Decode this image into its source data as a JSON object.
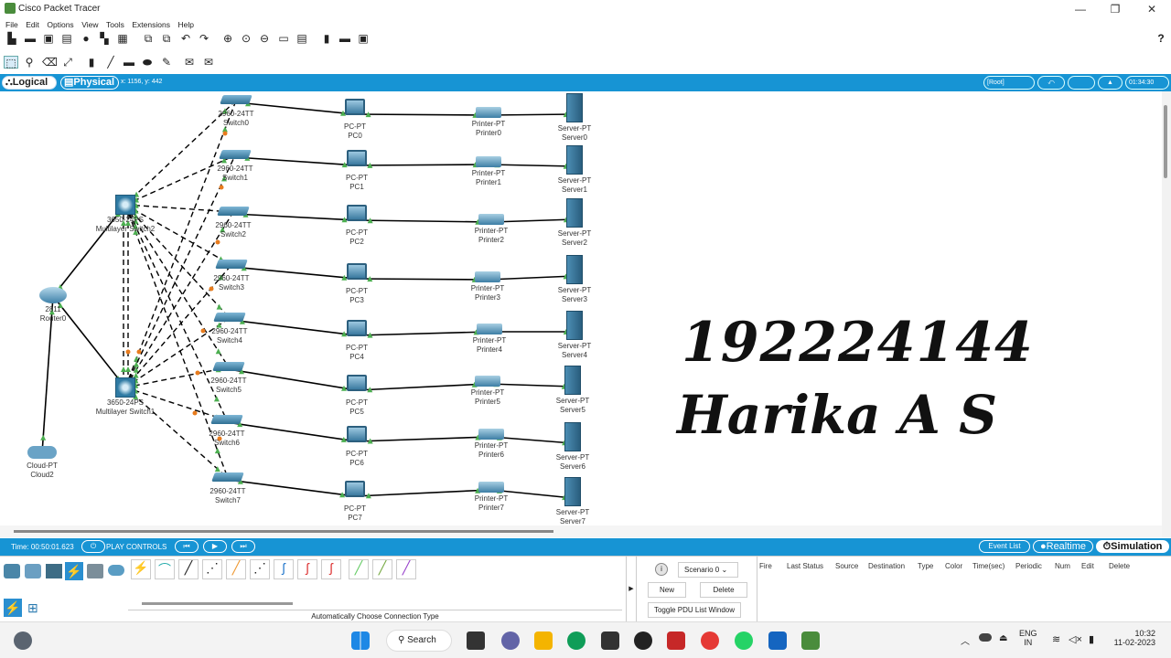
{
  "window": {
    "title": "Cisco Packet Tracer",
    "minimize": "—",
    "maximize": "❐",
    "close": "✕"
  },
  "menu": [
    "File",
    "Edit",
    "Options",
    "View",
    "Tools",
    "Extensions",
    "Help"
  ],
  "toolbar1_help": "?",
  "views": {
    "logical": "Logical",
    "physical": "Physical",
    "coords": "x: 1156, y: 442",
    "root": "[Root]",
    "clock": "01:34:30"
  },
  "devices": {
    "switches": [
      {
        "model": "2960-24TT",
        "name": "Switch0"
      },
      {
        "model": "2960-24TT",
        "name": "Switch1"
      },
      {
        "model": "2960-24TT",
        "name": "Switch2"
      },
      {
        "model": "2960-24TT",
        "name": "Switch3"
      },
      {
        "model": "2960-24TT",
        "name": "Switch4"
      },
      {
        "model": "2960-24TT",
        "name": "Switch5"
      },
      {
        "model": "2960-24TT",
        "name": "Switch6"
      },
      {
        "model": "2960-24TT",
        "name": "Switch7"
      }
    ],
    "pcs": [
      {
        "model": "PC-PT",
        "name": "PC0"
      },
      {
        "model": "PC-PT",
        "name": "PC1"
      },
      {
        "model": "PC-PT",
        "name": "PC2"
      },
      {
        "model": "PC-PT",
        "name": "PC3"
      },
      {
        "model": "PC-PT",
        "name": "PC4"
      },
      {
        "model": "PC-PT",
        "name": "PC5"
      },
      {
        "model": "PC-PT",
        "name": "PC6"
      },
      {
        "model": "PC-PT",
        "name": "PC7"
      }
    ],
    "printers": [
      {
        "model": "Printer-PT",
        "name": "Printer0"
      },
      {
        "model": "Printer-PT",
        "name": "Printer1"
      },
      {
        "model": "Printer-PT",
        "name": "Printer2"
      },
      {
        "model": "Printer-PT",
        "name": "Printer3"
      },
      {
        "model": "Printer-PT",
        "name": "Printer4"
      },
      {
        "model": "Printer-PT",
        "name": "Printer5"
      },
      {
        "model": "Printer-PT",
        "name": "Printer6"
      },
      {
        "model": "Printer-PT",
        "name": "Printer7"
      }
    ],
    "servers": [
      {
        "model": "Server-PT",
        "name": "Server0"
      },
      {
        "model": "Server-PT",
        "name": "Server1"
      },
      {
        "model": "Server-PT",
        "name": "Server2"
      },
      {
        "model": "Server-PT",
        "name": "Server3"
      },
      {
        "model": "Server-PT",
        "name": "Server4"
      },
      {
        "model": "Server-PT",
        "name": "Server5"
      },
      {
        "model": "Server-PT",
        "name": "Server6"
      },
      {
        "model": "Server-PT",
        "name": "Server7"
      }
    ],
    "ml_switch_top": {
      "model": "3650-24PS",
      "name": "Multilayer Switch2"
    },
    "ml_switch_bottom": {
      "model": "3650-24PS",
      "name": "Multilayer Switch1"
    },
    "router": {
      "model": "2811",
      "name": "Router0"
    },
    "cloud": {
      "model": "Cloud-PT",
      "name": "Cloud2"
    }
  },
  "annotation": {
    "number": "192224144",
    "name": "Harika A S"
  },
  "timebar": {
    "time": "Time: 00:50:01.623",
    "play_controls": "PLAY CONTROLS",
    "event_list": "Event List",
    "realtime": "Realtime",
    "simulation": "Simulation"
  },
  "bottom": {
    "connection_type": "Automatically Choose Connection Type",
    "scenario": "Scenario 0",
    "new": "New",
    "delete": "Delete",
    "toggle_pdu": "Toggle PDU List Window",
    "columns": [
      "Fire",
      "Last Status",
      "Source",
      "Destination",
      "Type",
      "Color",
      "Time(sec)",
      "Periodic",
      "Num",
      "Edit",
      "Delete"
    ]
  },
  "taskbar": {
    "search": "Search",
    "lang1": "ENG",
    "lang2": "IN",
    "time": "10:32",
    "date": "11-02-2023"
  },
  "colors": {
    "accent": "#1794d4",
    "link_green": "#4caf50",
    "link_orange": "#e87c1e"
  }
}
